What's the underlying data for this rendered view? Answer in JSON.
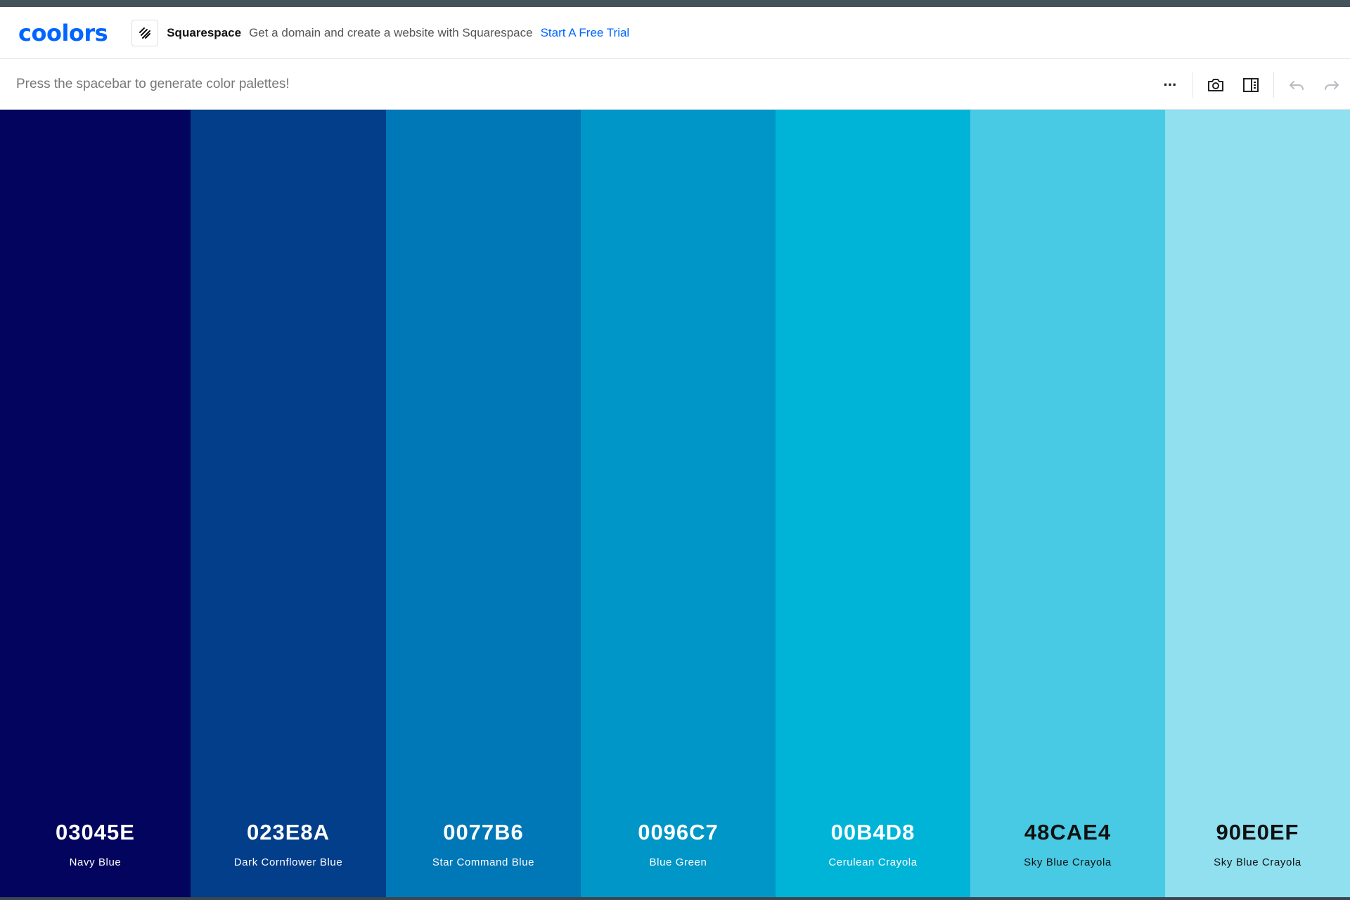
{
  "app": {
    "logo_text": "coolors"
  },
  "ad": {
    "brand": "Squarespace",
    "text": "Get a domain and create a website with Squarespace",
    "cta": "Start A Free Trial"
  },
  "toolbar": {
    "hint": "Press the spacebar to generate color palettes!",
    "more_label": "···",
    "icons": [
      "more-options-icon",
      "camera-icon",
      "sidebar-toggle-icon",
      "undo-icon",
      "redo-icon"
    ]
  },
  "palette": [
    {
      "hex": "03045E",
      "name": "Navy Blue",
      "color": "#03045e",
      "text_color": "#ffffff"
    },
    {
      "hex": "023E8A",
      "name": "Dark Cornflower Blue",
      "color": "#023e8a",
      "text_color": "#ffffff"
    },
    {
      "hex": "0077B6",
      "name": "Star Command Blue",
      "color": "#0077b6",
      "text_color": "#ffffff"
    },
    {
      "hex": "0096C7",
      "name": "Blue Green",
      "color": "#0096c7",
      "text_color": "#ffffff"
    },
    {
      "hex": "00B4D8",
      "name": "Cerulean Crayola",
      "color": "#00b4d8",
      "text_color": "#ffffff"
    },
    {
      "hex": "48CAE4",
      "name": "Sky Blue Crayola",
      "color": "#48cae4",
      "text_color": "#111111"
    },
    {
      "hex": "90E0EF",
      "name": "Sky Blue Crayola",
      "color": "#90e0ef",
      "text_color": "#111111"
    }
  ]
}
